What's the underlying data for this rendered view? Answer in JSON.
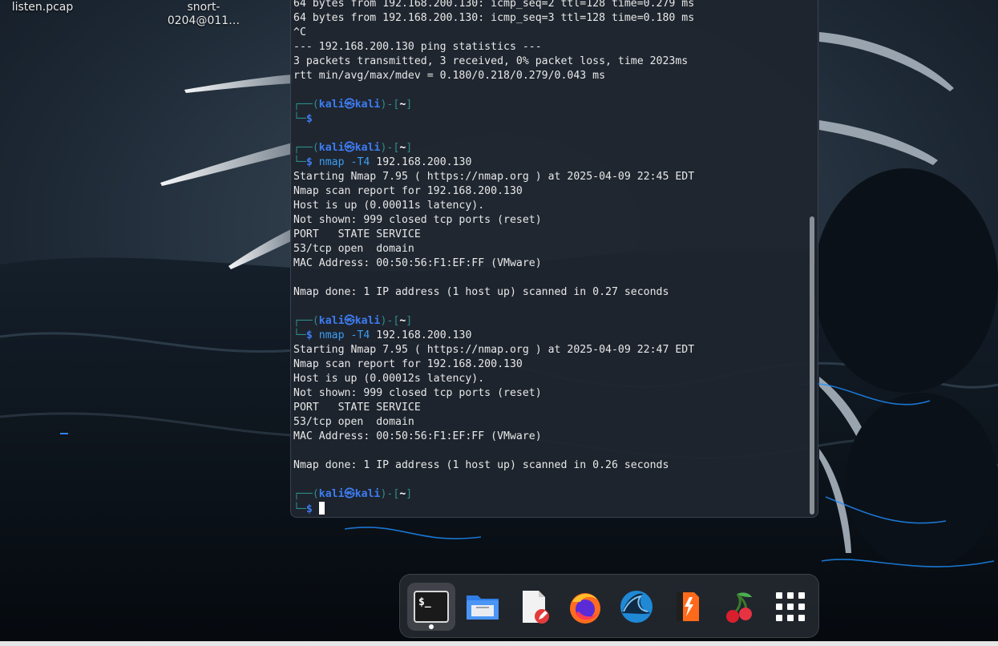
{
  "desktop": {
    "icons": [
      {
        "name": "listen.pcap"
      },
      {
        "name_line1": "snort-",
        "name_line2": "0204@011…"
      }
    ]
  },
  "terminal": {
    "prompt": {
      "user": "kali",
      "host": "kali",
      "dir": "~",
      "symbol": "$"
    },
    "lines": [
      {
        "type": "out",
        "text": "64 bytes from 192.168.200.130: icmp_seq=2 ttl=128 time=0.279 ms"
      },
      {
        "type": "out",
        "text": "64 bytes from 192.168.200.130: icmp_seq=3 ttl=128 time=0.180 ms"
      },
      {
        "type": "out",
        "text": "^C"
      },
      {
        "type": "out",
        "text": "--- 192.168.200.130 ping statistics ---"
      },
      {
        "type": "out",
        "text": "3 packets transmitted, 3 received, 0% packet loss, time 2023ms"
      },
      {
        "type": "out",
        "text": "rtt min/avg/max/mdev = 0.180/0.218/0.279/0.043 ms"
      },
      {
        "type": "blank",
        "text": ""
      },
      {
        "type": "prompt1",
        "text": ""
      },
      {
        "type": "prompt2",
        "cmd": "",
        "opt": "",
        "arg": ""
      },
      {
        "type": "blank",
        "text": ""
      },
      {
        "type": "prompt1",
        "text": ""
      },
      {
        "type": "prompt2",
        "cmd": "nmap",
        "opt": "-T4",
        "arg": "192.168.200.130"
      },
      {
        "type": "out",
        "text": "Starting Nmap 7.95 ( https://nmap.org ) at 2025-04-09 22:45 EDT"
      },
      {
        "type": "out",
        "text": "Nmap scan report for 192.168.200.130"
      },
      {
        "type": "out",
        "text": "Host is up (0.00011s latency)."
      },
      {
        "type": "out",
        "text": "Not shown: 999 closed tcp ports (reset)"
      },
      {
        "type": "out",
        "text": "PORT   STATE SERVICE"
      },
      {
        "type": "out",
        "text": "53/tcp open  domain"
      },
      {
        "type": "out",
        "text": "MAC Address: 00:50:56:F1:EF:FF (VMware)"
      },
      {
        "type": "blank",
        "text": ""
      },
      {
        "type": "out",
        "text": "Nmap done: 1 IP address (1 host up) scanned in 0.27 seconds"
      },
      {
        "type": "blank",
        "text": ""
      },
      {
        "type": "prompt1",
        "text": ""
      },
      {
        "type": "prompt2",
        "cmd": "nmap",
        "opt": "-T4",
        "arg": "192.168.200.130"
      },
      {
        "type": "out",
        "text": "Starting Nmap 7.95 ( https://nmap.org ) at 2025-04-09 22:47 EDT"
      },
      {
        "type": "out",
        "text": "Nmap scan report for 192.168.200.130"
      },
      {
        "type": "out",
        "text": "Host is up (0.00012s latency)."
      },
      {
        "type": "out",
        "text": "Not shown: 999 closed tcp ports (reset)"
      },
      {
        "type": "out",
        "text": "PORT   STATE SERVICE"
      },
      {
        "type": "out",
        "text": "53/tcp open  domain"
      },
      {
        "type": "out",
        "text": "MAC Address: 00:50:56:F1:EF:FF (VMware)"
      },
      {
        "type": "blank",
        "text": ""
      },
      {
        "type": "out",
        "text": "Nmap done: 1 IP address (1 host up) scanned in 0.26 seconds"
      },
      {
        "type": "blank",
        "text": ""
      },
      {
        "type": "prompt1",
        "text": ""
      },
      {
        "type": "prompt2",
        "cmd": "",
        "opt": "",
        "arg": "",
        "cursor": true
      }
    ]
  },
  "dock": {
    "items": [
      {
        "name": "terminal-emulator",
        "icon": "terminal-icon",
        "active": true
      },
      {
        "name": "file-manager",
        "icon": "folder-icon",
        "active": false
      },
      {
        "name": "text-editor",
        "icon": "text-editor-icon",
        "active": false
      },
      {
        "name": "firefox",
        "icon": "firefox-icon",
        "active": false
      },
      {
        "name": "wireshark",
        "icon": "wireshark-fin-icon",
        "active": false
      },
      {
        "name": "burp-suite",
        "icon": "burp-suite-icon",
        "active": false
      },
      {
        "name": "cherrytree",
        "icon": "cherry-icon",
        "active": false
      },
      {
        "name": "show-applications",
        "icon": "app-grid-icon",
        "active": false
      }
    ]
  },
  "colors": {
    "terminal_bg": "#1f252f",
    "prompt_blue": "#3d7cf2",
    "prompt_frame": "#2e8d8a",
    "accent": "#3d9df2"
  }
}
